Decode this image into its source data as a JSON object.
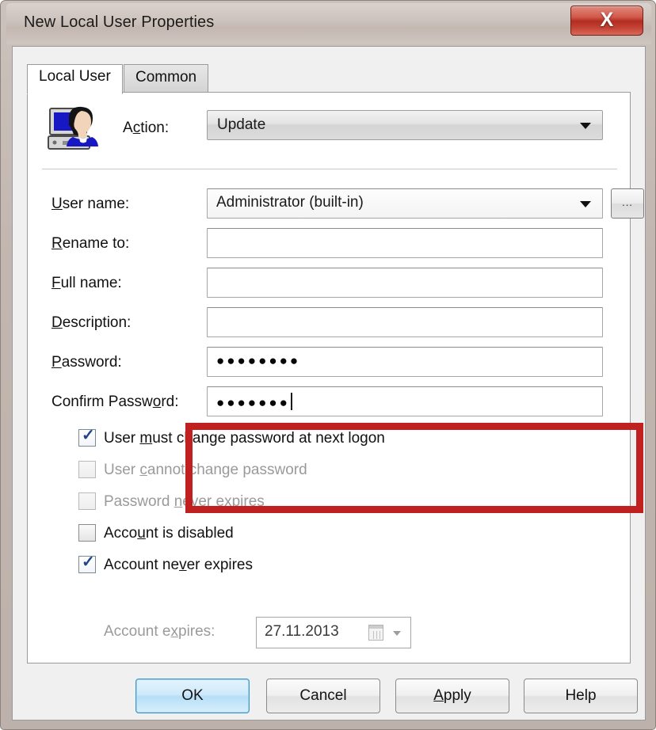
{
  "window": {
    "title": "New Local User Properties",
    "close_label": "X",
    "close_icon": "close-icon"
  },
  "tabs": [
    {
      "label": "Local User",
      "active": true
    },
    {
      "label": "Common",
      "active": false
    }
  ],
  "action": {
    "icon": "local-user-account-icon",
    "label": "Action:",
    "value": "Update",
    "arrow_icon": "chevron-down-icon"
  },
  "fields": [
    {
      "name": "user-name",
      "label_pre": "",
      "label_key": "U",
      "label_post": "ser name:",
      "value": "Administrator (built-in)",
      "type": "combo",
      "has_browse": true,
      "browse_label": "...",
      "arrow_icon": "chevron-down-icon"
    },
    {
      "name": "rename-to",
      "label_pre": "",
      "label_key": "R",
      "label_post": "ename to:",
      "value": "",
      "type": "text",
      "has_browse": false
    },
    {
      "name": "full-name",
      "label_pre": "",
      "label_key": "F",
      "label_post": "ull name:",
      "value": "",
      "type": "text",
      "has_browse": false
    },
    {
      "name": "description",
      "label_pre": "",
      "label_key": "D",
      "label_post": "escription:",
      "value": "",
      "type": "text",
      "has_browse": false
    },
    {
      "name": "password",
      "label_pre": "",
      "label_key": "P",
      "label_post": "assword:",
      "value": "●●●●●●●●",
      "type": "password",
      "has_browse": false,
      "dot_count": 8
    },
    {
      "name": "confirm-password",
      "label_pre": "Confirm Passw",
      "label_key": "o",
      "label_post": "rd:",
      "value": "●●●●●●●",
      "type": "password",
      "has_browse": false,
      "dot_count": 7,
      "focused": true
    }
  ],
  "checkboxes": [
    {
      "name": "user-must-change-password",
      "label_pre": "User ",
      "label_key": "m",
      "label_post": "ust change password at next logon",
      "checked": true,
      "disabled": false
    },
    {
      "name": "user-cannot-change-password",
      "label_pre": "User ",
      "label_key": "c",
      "label_post": "annot change password",
      "checked": false,
      "disabled": true
    },
    {
      "name": "password-never-expires",
      "label_pre": "Password ",
      "label_key": "n",
      "label_post": "ever expires",
      "checked": false,
      "disabled": true
    },
    {
      "name": "account-is-disabled",
      "label_pre": "Acco",
      "label_key": "u",
      "label_post": "nt is disabled",
      "checked": false,
      "disabled": false
    },
    {
      "name": "account-never-expires",
      "label_pre": "Account ne",
      "label_key": "v",
      "label_post": "er expires",
      "checked": true,
      "disabled": false
    }
  ],
  "account_expires": {
    "label_pre": "Account e",
    "label_key": "x",
    "label_post": "pires:",
    "value": "27.11.2013",
    "calendar_icon": "calendar-icon",
    "arrow_icon": "chevron-down-icon",
    "disabled": true
  },
  "buttons": [
    {
      "name": "ok",
      "label": "OK",
      "default": true
    },
    {
      "name": "cancel",
      "label": "Cancel",
      "default": false
    },
    {
      "name": "apply",
      "label_pre": "",
      "label_key": "A",
      "label_post": "pply",
      "label": "Apply",
      "default": false
    },
    {
      "name": "help",
      "label": "Help",
      "default": false
    }
  ],
  "annotation": {
    "type": "red-highlight-rectangle",
    "color": "#c0201f",
    "targets": "password and confirm password fields"
  },
  "colors": {
    "frame": "#c4b8b1",
    "close_button": "#c44234",
    "client_background": "#f0f0f0",
    "panel_background": "#ffffff",
    "highlight": "#c0201f",
    "default_button": "#b6dff8"
  }
}
